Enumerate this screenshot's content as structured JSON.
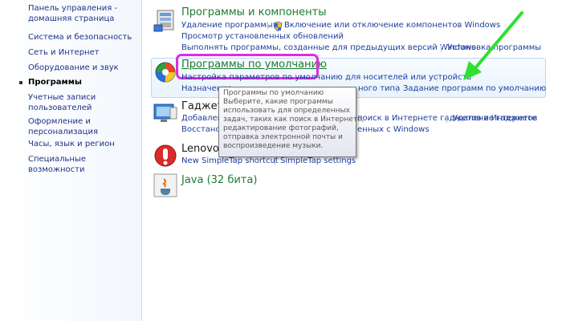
{
  "sidebar": {
    "items": [
      {
        "label": "Панель управления -"
      },
      {
        "label": "домашняя страница"
      },
      {
        "label": "Система и безопасность"
      },
      {
        "label": "Сеть и Интернет"
      },
      {
        "label": "Оборудование и звук"
      },
      {
        "label": "Программы"
      },
      {
        "label": "Учетные записи"
      },
      {
        "label": "пользователей"
      },
      {
        "label": "Оформление и"
      },
      {
        "label": "персонализация"
      },
      {
        "label": "Часы, язык и регион"
      },
      {
        "label": "Специальные возможности"
      }
    ]
  },
  "categories": {
    "programs": {
      "title": "Программы и компоненты",
      "links": [
        "Удаление программы",
        "Включение или отключение компонентов Windows",
        "Просмотр установленных обновлений",
        "Выполнять программы, созданные для предыдущих версий Windows",
        "Установка программы"
      ]
    },
    "defaults": {
      "title": "Программы по умолчанию",
      "links": [
        "Настройка параметров по умолчанию для носителей или устройств",
        "Назначение",
        "ного типа",
        "Задание программ по умолчанию"
      ]
    },
    "gadgets": {
      "title": "Гаджеты",
      "links": [
        "Добавлени",
        "поиск в Интернете гаджетов в Интернете",
        "Удаление гаджетов",
        "Восстанов",
        "енных с Windows"
      ]
    },
    "lenovo": {
      "title": "Lenovo's",
      "links": [
        "New SimpleTap shortcut",
        "SimpleTap settings"
      ]
    },
    "java": {
      "title": "Java (32 бита)"
    }
  },
  "tooltip": {
    "lines": [
      "Программы по умолчанию",
      "Выберите, какие программы",
      "использовать для определенных",
      "задач, таких как поиск в Интернете,",
      "редактирование фотографий,",
      "отправка электронной почты и",
      "воспроизведение музыки."
    ]
  }
}
